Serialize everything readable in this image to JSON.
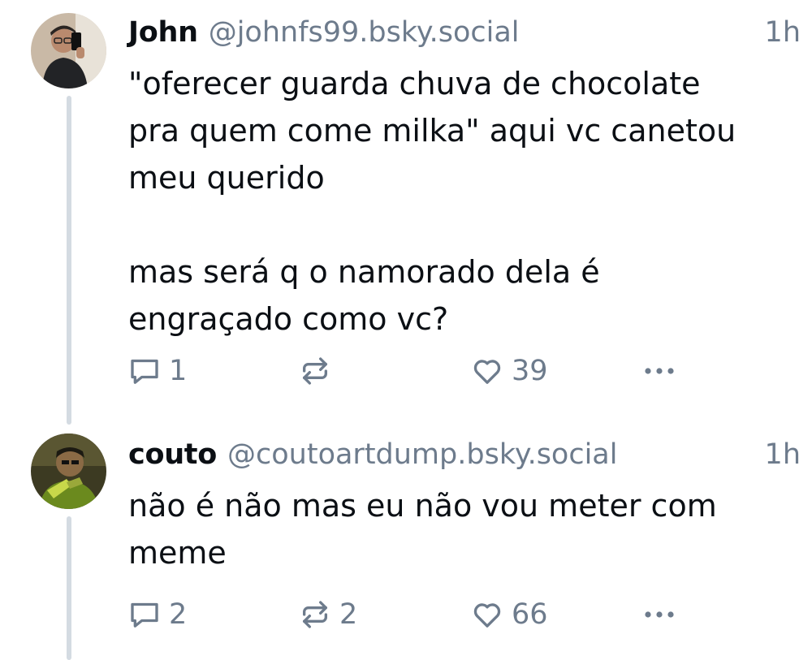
{
  "posts": [
    {
      "author_name": "John",
      "author_handle": "@johnfs99.bsky.social",
      "time": "1h",
      "text": "\"oferecer guarda chuva de chocolate\npra quem come milka\" aqui vc canetou\nmeu querido\n\nmas será q o namorado dela é\nengraçado como vc?",
      "reply_count": "1",
      "repost_count": "",
      "like_count": "39",
      "icons": {
        "reply": "reply-icon",
        "repost": "repost-icon",
        "like": "heart-icon",
        "more": "more-icon"
      }
    },
    {
      "author_name": "couto",
      "author_handle": "@coutoartdump.bsky.social",
      "time": "1h",
      "text": "não é não mas eu não vou meter com\nmeme",
      "reply_count": "2",
      "repost_count": "2",
      "like_count": "66",
      "icons": {
        "reply": "reply-icon",
        "repost": "repost-icon",
        "like": "heart-icon",
        "more": "more-icon"
      }
    }
  ],
  "colors": {
    "text": "#0b0f14",
    "muted": "#6d7b8c",
    "thread_line": "#d4dbe2",
    "background": "#ffffff"
  }
}
